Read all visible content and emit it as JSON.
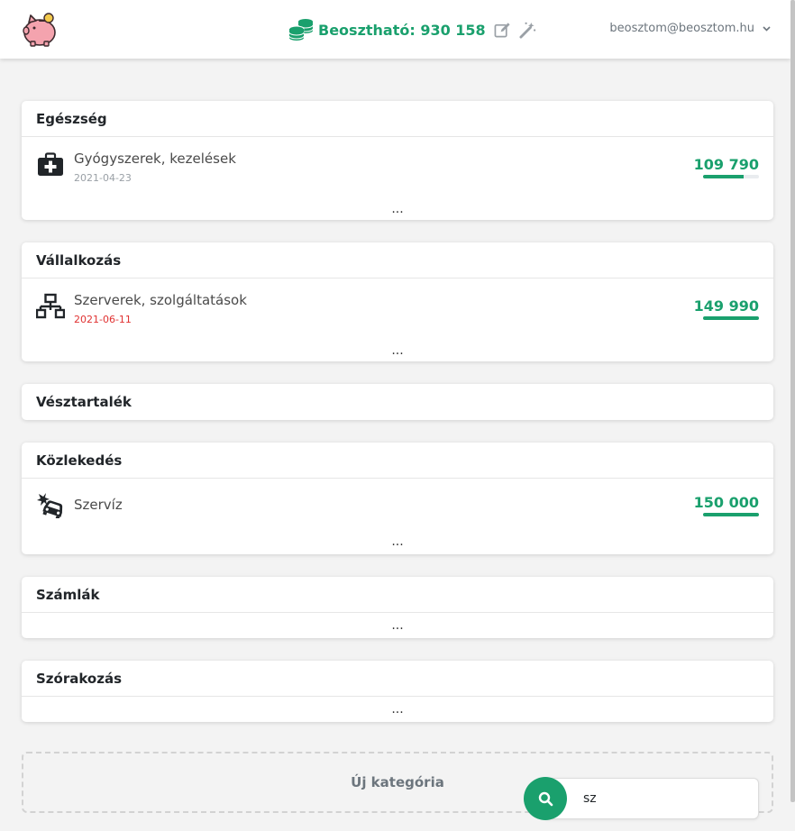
{
  "header": {
    "logo": "piggy-bank-logo",
    "budget_label": "Beosztható: 930 158",
    "budget_icon": "coins-icon",
    "edit_icon": "edit-icon",
    "magic_icon": "magic-wand-icon",
    "user_email": "beosztom@beosztom.hu",
    "colors": {
      "accent": "#1aa06d",
      "overdue": "#e03131"
    }
  },
  "categories": [
    {
      "name": "Egészség",
      "items": [
        {
          "icon": "first-aid-kit-icon",
          "name": "Gyógyszerek, kezelések",
          "date": "2021-04-23",
          "amount": "109 790",
          "progress": 0.73
        }
      ],
      "more": "..."
    },
    {
      "name": "Vállalkozás",
      "items": [
        {
          "icon": "network-icon",
          "name": "Szerverek, szolgáltatások",
          "date": "2021-06-11",
          "amount": "149 990",
          "progress": 1.0,
          "overdue": true
        }
      ],
      "more": "..."
    },
    {
      "name": "Vésztartalék"
    },
    {
      "name": "Közlekedés",
      "items": [
        {
          "icon": "car-crash-icon",
          "name": "Szervíz",
          "amount": "150 000",
          "progress": 1.0
        }
      ],
      "more": "..."
    },
    {
      "name": "Számlák",
      "more": "..."
    },
    {
      "name": "Szórakozás",
      "more": "..."
    }
  ],
  "new_category": "Új kategória",
  "search": {
    "value": "sz",
    "icon": "search-icon"
  }
}
